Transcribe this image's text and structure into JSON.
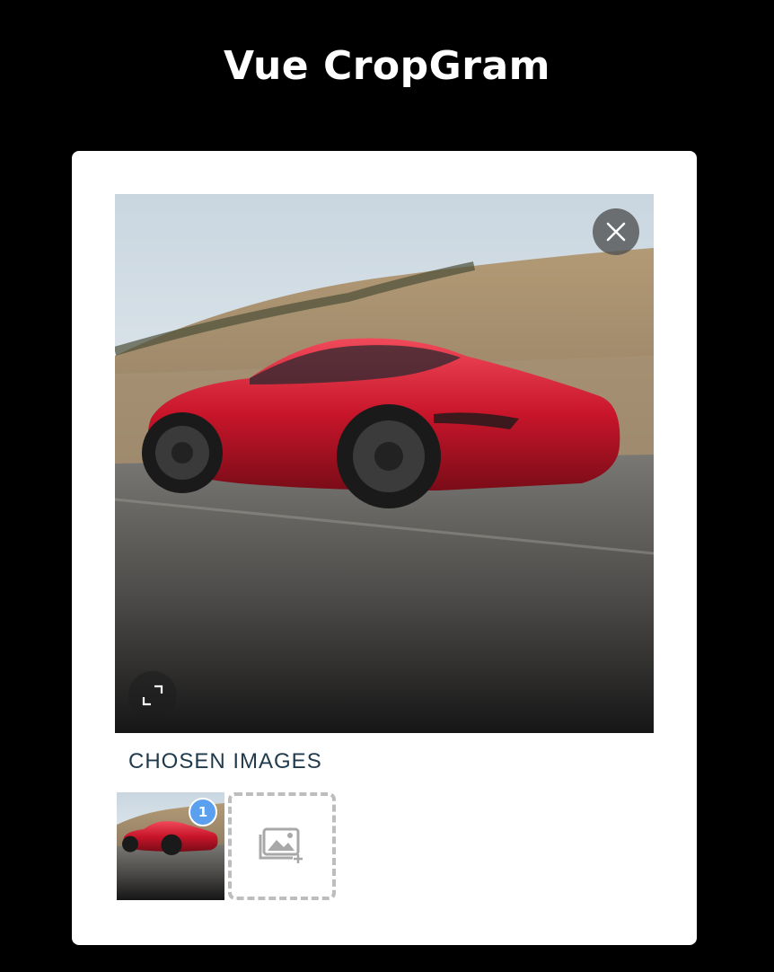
{
  "header": {
    "title": "Vue CropGram"
  },
  "preview": {
    "image_alt": "Red sports car on road",
    "close_icon": "close-icon",
    "expand_icon": "expand-icon"
  },
  "chosen": {
    "label": "CHOSEN IMAGES",
    "items": [
      {
        "badge": "1"
      }
    ],
    "add_icon": "add-image-icon"
  },
  "colors": {
    "background": "#000000",
    "card": "#ffffff",
    "label": "#1f3a4d",
    "badge": "#5aa0ef",
    "dashed_border": "#bdbdbd"
  }
}
